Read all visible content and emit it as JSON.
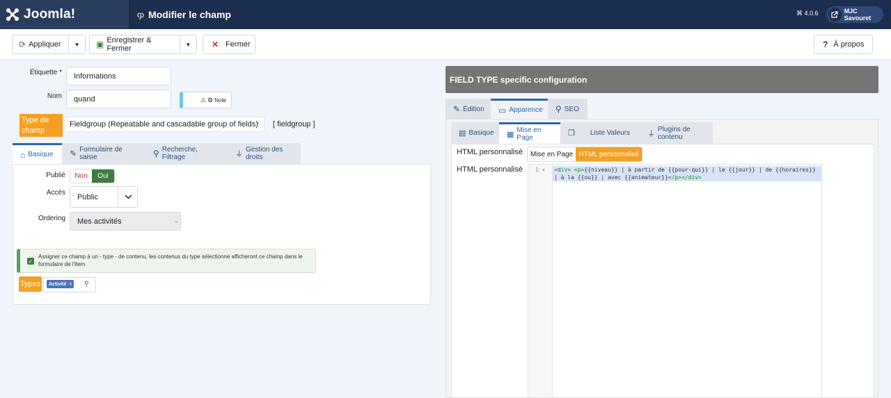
{
  "header": {
    "logo_text": "Joomla!",
    "title": "Modifier le champ",
    "version": "4.0.6",
    "user": "MJC Savouret"
  },
  "toolbar": {
    "apply": "Appliquer",
    "save_close": "Enregistrer & Fermer",
    "close": "Fermer",
    "about": "À propos"
  },
  "form": {
    "label_label": "Étiquette *",
    "label_value": "Informations",
    "name_label": "Nom",
    "name_value": "quand",
    "note_label": "Note",
    "type_label": "Type de champ",
    "type_value": "Fieldgroup (Repeatable and cascadable group of fields)",
    "type_code": "[ fieldgroup ]"
  },
  "left_tabs": [
    "Basique",
    "Formulaire de saisie",
    "Recherche, Filtrage",
    "Gestion des droits"
  ],
  "basic": {
    "published_label": "Publié",
    "no": "Non",
    "yes": "Oui",
    "access_label": "Accès",
    "access_value": "Public",
    "ordering_label": "Ordering",
    "ordering_value": "Mes activités",
    "ordering_suffix": "-",
    "alert_text": "Assigner ce champ à un - type - de contenu, les contenus du type sélectionné afficheront ce champ dans le formulaire de l'item",
    "types_label": "Types",
    "type_chip": "Activité",
    "chip_remove": "×"
  },
  "right": {
    "header": "FIELD TYPE specific configuration",
    "tabs": [
      "Édition",
      "Apparence",
      "SEO"
    ],
    "subtabs": [
      "Basique",
      "Mise en Page",
      "Liste Valeurs",
      "Plugins de contenu"
    ],
    "html_label_1": "HTML personnalisé",
    "html_label_2": "HTML personnalisé",
    "opt_layout": "Mise en Page",
    "opt_custom": "HTML personnalisé",
    "line_number": "1",
    "code_open_tags": "<div> <p>",
    "code_text": "{{niveau}} | à partir de {{pour-qui}} | le {{jour}} | de {{horaires}} | à la {{ou}} | avec {{animateur}}",
    "code_close_tags": "</p></div>"
  },
  "colors": {
    "header_bg": "#1c2f4f",
    "accent_orange": "#f4a023",
    "success_green": "#3f7c3f",
    "tab_blue": "#2f64a8"
  }
}
